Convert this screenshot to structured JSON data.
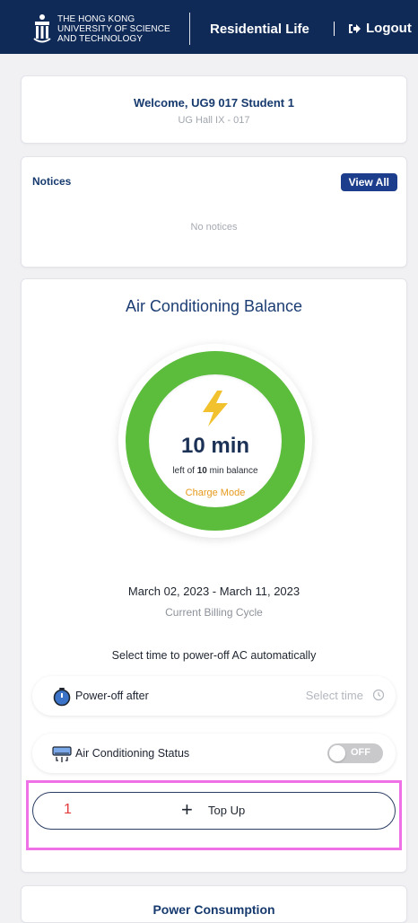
{
  "header": {
    "org_line1": "THE HONG KONG",
    "org_line2": "UNIVERSITY OF SCIENCE",
    "org_line3": "AND TECHNOLOGY",
    "app_title": "Residential Life",
    "logout_label": "Logout",
    "logout_icon": "logout-icon",
    "bg_color": "#0f2a57"
  },
  "welcome": {
    "greeting": "Welcome, UG9 017 Student 1",
    "hall": "UG Hall IX - 017"
  },
  "notices": {
    "title": "Notices",
    "view_all_label": "View All",
    "empty_text": "No notices"
  },
  "ac_balance": {
    "title": "Air Conditioning Balance",
    "remaining_display": "10 min",
    "left_of_prefix": "left of ",
    "total": "10",
    "left_of_suffix": " min balance",
    "mode": "Charge Mode",
    "ring_color": "#5bbd3b",
    "billing_dates": "March 02, 2023 - March 11, 2023",
    "billing_label": "Current Billing Cycle",
    "auto_off_prompt": "Select time to power-off AC automatically",
    "power_off_label": "Power-off after",
    "power_off_value": "Select time",
    "status_label": "Air Conditioning Status",
    "status_toggle": "OFF",
    "topup_marker": "1",
    "topup_label": "Top Up"
  },
  "power_consumption": {
    "title": "Power Consumption"
  }
}
